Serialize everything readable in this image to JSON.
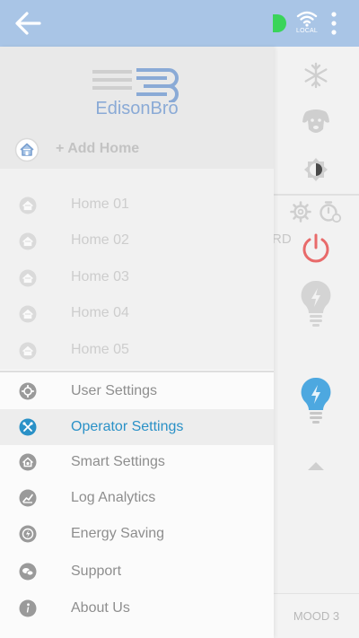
{
  "topbar": {
    "back_icon": "arrow-left-icon",
    "status_color": "#3ad45a",
    "wifi_label": "LOCAL",
    "menu_icon": "more-vertical-icon"
  },
  "drawer": {
    "brand": "EdisonBro",
    "add_home_label": "+ Add Home",
    "homes": [
      {
        "label": "Home 01",
        "icon": "home-icon"
      },
      {
        "label": "Home 02",
        "icon": "home-icon"
      },
      {
        "label": "Home 03",
        "icon": "home-icon"
      },
      {
        "label": "Home 04",
        "icon": "home-icon"
      },
      {
        "label": "Home 05",
        "icon": "home-icon"
      }
    ],
    "menu": [
      {
        "label": "User Settings",
        "icon": "gear-icon",
        "active": false
      },
      {
        "label": "Operator Settings",
        "icon": "tools-icon",
        "active": true
      },
      {
        "label": "Smart Settings",
        "icon": "smart-home-icon",
        "active": false
      },
      {
        "label": "Log Analytics",
        "icon": "chart-icon",
        "active": false
      },
      {
        "label": "Energy Saving",
        "icon": "energy-icon",
        "active": false
      },
      {
        "label": "Support",
        "icon": "support-icon",
        "active": false
      },
      {
        "label": "About Us",
        "icon": "info-icon",
        "active": false
      }
    ]
  },
  "background_panel": {
    "partial_text": "RD",
    "mood_label": "MOOD 3",
    "icons": [
      "snowflake-icon",
      "dog-icon",
      "brightness-icon",
      "settings-icon",
      "timer-icon",
      "power-icon",
      "bulb-off-icon",
      "bulb-on-icon",
      "arrow-up-icon"
    ]
  },
  "colors": {
    "topbar": "#a9c5e6",
    "accent": "#2a91c7",
    "brand": "#8aaad6",
    "power": "#e86a6a",
    "bulb_on": "#4da8e0"
  }
}
